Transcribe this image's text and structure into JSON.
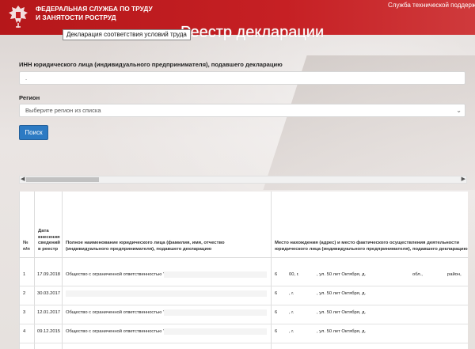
{
  "header": {
    "org_name": "ФЕДЕРАЛЬНАЯ СЛУЖБА ПО ТРУДУ И ЗАНЯТОСТИ РОСТРУД",
    "support_link": "Служба технической поддержки",
    "tooltip": "Декларация соответствия условий труда",
    "page_title": "Реестр декларации"
  },
  "form": {
    "inn_label": "ИНН юридического лица (индивидуального предпринимателя), подавшего декларацию",
    "inn_value": ".",
    "region_label": "Регион",
    "region_placeholder": "Выберите регион из списка",
    "search_button": "Поиск"
  },
  "table": {
    "headers": {
      "num": "№ п/п",
      "date": "Дата внесения сведений в реестр",
      "name": "Полное наименование юридического лица (фамилия, имя, отчество (индивидуального предпринимателя), подавшего декларацию",
      "address": "Место нахождения (адрес) и место фактического осуществления деятельности юридического лица (индивидуального предпринимателя), подавшего декларацию"
    },
    "rows": [
      {
        "num": "1",
        "date": "17.09.2018",
        "name": "Общество с ограниченной ответственностью \"",
        "addr_a": "6",
        "addr_b": "00, г.",
        "addr_c": ", ул. 50 лет Октября, д.",
        "addr_d": "обл.,",
        "addr_e": "район,"
      },
      {
        "num": "2",
        "date": "30.03.2017",
        "name": "",
        "addr_a": "6",
        "addr_b": ", г.",
        "addr_c": ", ул. 50 лет Октября, д.",
        "addr_d": "",
        "addr_e": ""
      },
      {
        "num": "3",
        "date": "12.01.2017",
        "name": "Общество с ограниченной ответственностью \"",
        "addr_a": "6",
        "addr_b": ", г.",
        "addr_c": ", ул. 50 лет Октября, д.",
        "addr_d": "",
        "addr_e": ""
      },
      {
        "num": "4",
        "date": "09.12.2015",
        "name": "Общество с ограниченной ответственностью \"",
        "addr_a": "6",
        "addr_b": ", г.",
        "addr_c": ", ул. 50 лет Октября, д.",
        "addr_d": "",
        "addr_e": ""
      }
    ]
  },
  "icons": {
    "emblem": "double-headed-eagle-emblem",
    "select": "chevron-down-icon",
    "scroll_left": "scroll-left-arrow-icon",
    "scroll_right": "scroll-right-arrow-icon"
  },
  "colors": {
    "header_red": "#c62024",
    "button_blue": "#2c7ac3"
  }
}
